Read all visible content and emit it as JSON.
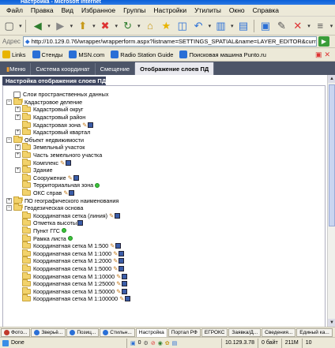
{
  "window": {
    "title": "Настройка - Microsoft Internet"
  },
  "menu": [
    "Файл",
    "Правка",
    "Вид",
    "Избранное",
    "Группы",
    "Настройки",
    "Утилиты",
    "Окно",
    "Справка"
  ],
  "address": {
    "label": "Адрес",
    "url": "http://10.129.0.76/wrapper/wrapperform.aspx?listname=SETTINGS_SPATIAL&name=LAYER_EDITOR&current=LAYE"
  },
  "links": [
    {
      "label": "Links"
    },
    {
      "label": "Стенды"
    },
    {
      "label": "MSN.com"
    },
    {
      "label": "Radio Station Guide"
    },
    {
      "label": "Поисковая машина Punto.ru"
    }
  ],
  "nav": {
    "tabs": [
      {
        "label": "Меню"
      },
      {
        "label": "Система координат"
      },
      {
        "label": "Смещение"
      },
      {
        "label": "Отображение слоев ПД"
      }
    ],
    "active_index": 3
  },
  "panel": {
    "title": "Настройка отображения слоев ПД АИС ГКН"
  },
  "tree": [
    {
      "label": "Слои пространственных данных",
      "level": 0,
      "exp": "none",
      "type": "root"
    },
    {
      "label": "Кадастровое деление",
      "level": 0,
      "exp": "minus",
      "type": "stack"
    },
    {
      "label": "Кадастровый округ",
      "level": 1,
      "exp": "plus",
      "type": "folder"
    },
    {
      "label": "Кадастровый район",
      "level": 1,
      "exp": "plus",
      "type": "folder"
    },
    {
      "label": "Кадастровая зона",
      "level": 1,
      "exp": "none",
      "type": "folder",
      "icons": [
        "pencil",
        "disk"
      ]
    },
    {
      "label": "Кадастровый квартал",
      "level": 1,
      "exp": "plus",
      "type": "folder"
    },
    {
      "label": "Объект недвижимости",
      "level": 0,
      "exp": "minus",
      "type": "stack"
    },
    {
      "label": "Земельный участок",
      "level": 1,
      "exp": "plus",
      "type": "folder"
    },
    {
      "label": "Часть земельного участка",
      "level": 1,
      "exp": "plus",
      "type": "folder"
    },
    {
      "label": "Комплекс",
      "level": 1,
      "exp": "none",
      "type": "folder",
      "icons": [
        "pencil",
        "disk"
      ]
    },
    {
      "label": "Здание",
      "level": 1,
      "exp": "plus",
      "type": "folder"
    },
    {
      "label": "Сооружение",
      "level": 1,
      "exp": "none",
      "type": "folder",
      "icons": [
        "pencil",
        "disk"
      ]
    },
    {
      "label": "Территориальная зона",
      "level": 1,
      "exp": "none",
      "type": "folder",
      "icons": [
        "green"
      ]
    },
    {
      "label": "ОКС справ",
      "level": 1,
      "exp": "none",
      "type": "folder",
      "icons": [
        "pencil",
        "disk"
      ]
    },
    {
      "label": "ПО географического наименования",
      "level": 0,
      "exp": "plus",
      "type": "stack"
    },
    {
      "label": "Геодезическая основа",
      "level": 0,
      "exp": "minus",
      "type": "stack"
    },
    {
      "label": "Координатная сетка (линия)",
      "level": 1,
      "exp": "none",
      "type": "folder",
      "icons": [
        "pencil",
        "disk"
      ]
    },
    {
      "label": "Отметка высоты",
      "level": 1,
      "exp": "none",
      "type": "folder",
      "icons": [
        "disk"
      ]
    },
    {
      "label": "Пункт ГГС",
      "level": 1,
      "exp": "none",
      "type": "folder",
      "icons": [
        "green"
      ]
    },
    {
      "label": "Рамка листа",
      "level": 1,
      "exp": "none",
      "type": "folder",
      "icons": [
        "green"
      ]
    },
    {
      "label": "Координатная сетка М 1:500",
      "level": 1,
      "exp": "none",
      "type": "folder",
      "icons": [
        "pencil",
        "disk"
      ]
    },
    {
      "label": "Координатная сетка М 1:1000",
      "level": 1,
      "exp": "none",
      "type": "folder",
      "icons": [
        "pencil",
        "disk"
      ]
    },
    {
      "label": "Координатная сетка М 1:2000",
      "level": 1,
      "exp": "none",
      "type": "folder",
      "icons": [
        "pencil",
        "disk"
      ]
    },
    {
      "label": "Координатная сетка М 1:5000",
      "level": 1,
      "exp": "none",
      "type": "folder",
      "icons": [
        "pencil",
        "disk"
      ]
    },
    {
      "label": "Координатная сетка М 1:10000",
      "level": 1,
      "exp": "none",
      "type": "folder",
      "icons": [
        "pencil",
        "disk"
      ]
    },
    {
      "label": "Координатная сетка М 1:25000",
      "level": 1,
      "exp": "none",
      "type": "folder",
      "icons": [
        "pencil",
        "disk"
      ]
    },
    {
      "label": "Координатная сетка М 1:50000",
      "level": 1,
      "exp": "none",
      "type": "folder",
      "icons": [
        "pencil",
        "disk"
      ]
    },
    {
      "label": "Координатная сетка М 1:100000",
      "level": 1,
      "exp": "none",
      "type": "folder",
      "icons": [
        "pencil",
        "disk"
      ]
    }
  ],
  "taskbar": [
    {
      "label": "Фото...",
      "color": "#c0392b"
    },
    {
      "label": "Зверьё...",
      "color": "#2a6fd6"
    },
    {
      "label": "Позиц...",
      "color": "#2a6fd6"
    },
    {
      "label": "Стильн...",
      "color": "#2a6fd6"
    },
    {
      "label": "Настройка",
      "active": true
    },
    {
      "label": "Портал РФ"
    },
    {
      "label": "ЕГРОКС"
    },
    {
      "label": "Заявка/Д..."
    },
    {
      "label": "Сведения..."
    },
    {
      "label": "Единый ка..."
    }
  ],
  "status": {
    "text": "Done",
    "ip": "10.129.3.78",
    "bytes": "0 байт",
    "memory": "211M",
    "count": "10",
    "zero": "0"
  },
  "colors": {
    "nav_bg": "#4d5568",
    "panel_title_bg": "#3e4660"
  }
}
